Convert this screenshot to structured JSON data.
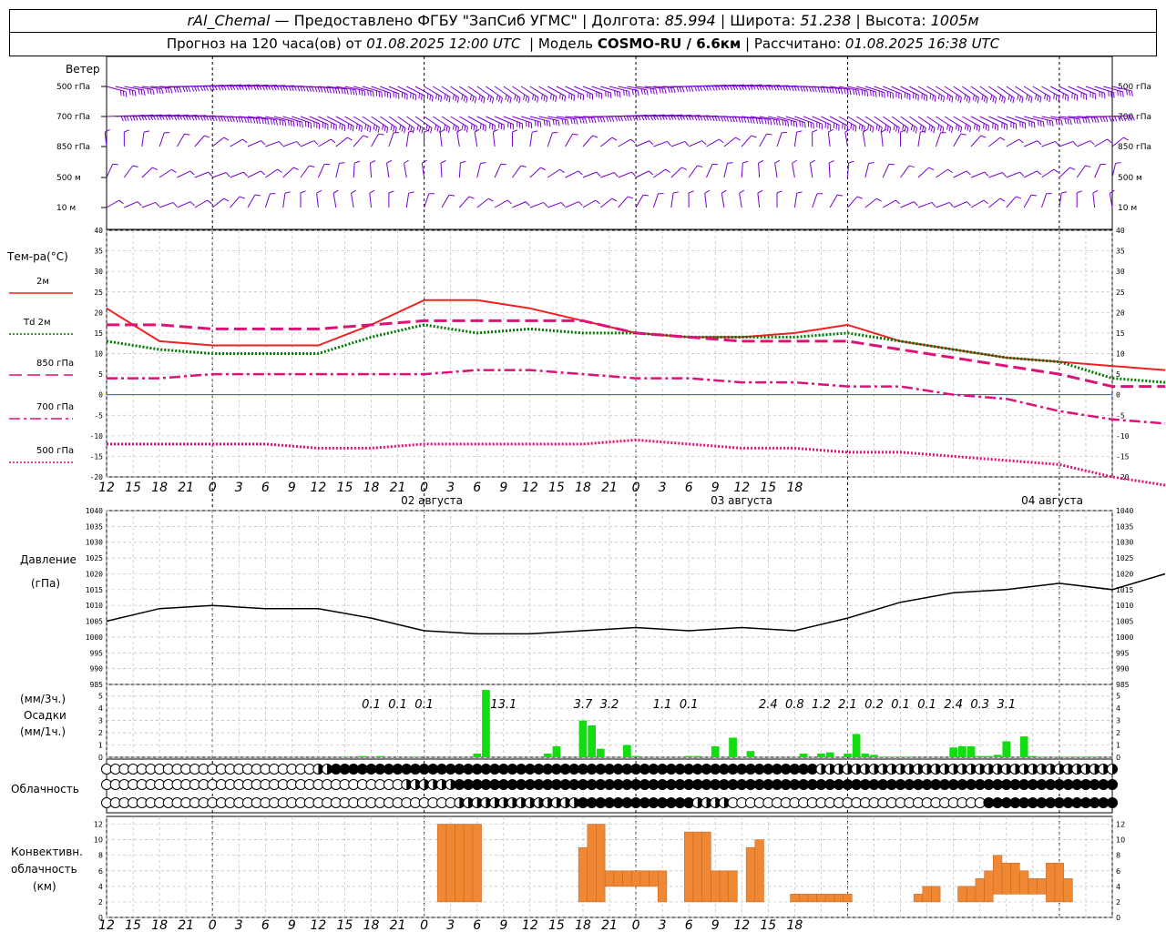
{
  "header": {
    "row1": {
      "station": "rAl_Chemal",
      "provider": "— Предоставлено ФГБУ \"ЗапСиб УГМС\"",
      "lon_label": "Долгота:",
      "lon": "85.994",
      "lat_label": "Широта:",
      "lat": "51.238",
      "alt_label": "Высота:",
      "alt": "1005м"
    },
    "row2": {
      "forecast": "Прогноз на 120 часа(ов) от",
      "issued": "01.08.2025 12:00 UTC",
      "model_label": "Модель",
      "model": "COSMO-RU / 6.6км",
      "calc_label": "Рассчитано:",
      "calc": "01.08.2025 16:38 UTC"
    }
  },
  "wind_panel": {
    "title": "Ветер",
    "levels": [
      "500 гПа",
      "700 гПа",
      "850 гПа",
      "500 м",
      "10 м"
    ],
    "color": "#7700cc"
  },
  "temp_panel": {
    "title": "Тем-ра(°C)",
    "legend": [
      {
        "label": "2м",
        "color": "#ee2222",
        "style": "solid"
      },
      {
        "label": "Td 2м",
        "color": "#007700",
        "style": "dotted"
      },
      {
        "label": "850 гПа",
        "color": "#dd1177",
        "style": "dash"
      },
      {
        "label": "700 гПа",
        "color": "#dd1177",
        "style": "dashdot"
      },
      {
        "label": "500 гПа",
        "color": "#dd1177",
        "style": "dots"
      }
    ],
    "yticks": [
      "40",
      "35",
      "30",
      "25",
      "20",
      "15",
      "10",
      "5",
      "0",
      "-5",
      "-10",
      "-15",
      "-20"
    ],
    "xticks": [
      "12",
      "15",
      "18",
      "21",
      "0",
      "3",
      "6",
      "9",
      "12",
      "15",
      "18",
      "21",
      "0",
      "3",
      "6",
      "9",
      "12",
      "15",
      "18",
      "21",
      "0",
      "3",
      "6",
      "9",
      "12",
      "15",
      "18"
    ],
    "dates": [
      "02 августа",
      "03 августа",
      "04 августа"
    ]
  },
  "pressure_panel": {
    "title1": "Давление",
    "title2": "(гПа)",
    "yticks": [
      "1040",
      "1035",
      "1030",
      "1025",
      "1020",
      "1015",
      "1010",
      "1005",
      "1000",
      "995",
      "990",
      "985"
    ]
  },
  "precip_panel": {
    "label1": "(мм/3ч.)",
    "label2": "Осадки",
    "label3": "(мм/1ч.)",
    "yticks": [
      "5",
      "4",
      "3",
      "2",
      "1",
      "0"
    ],
    "totals": [
      "0.1",
      "0.1",
      "0.1",
      "13.1",
      "3.7",
      "3.2",
      "1.1",
      "0.1",
      "2.4",
      "0.8",
      "1.2",
      "2.1",
      "0.2",
      "0.1",
      "0.1",
      "2.4",
      "0.3",
      "3.1"
    ],
    "color": "#11dd11"
  },
  "cloud_panel": {
    "title": "Облачность"
  },
  "conv_panel": {
    "title1": "Конвективн.",
    "title2": "облачность",
    "title3": "(км)",
    "yticks": [
      "12",
      "10",
      "8",
      "6",
      "4",
      "2",
      "0"
    ],
    "color": "#ee8833"
  },
  "chart_data": [
    {
      "type": "line",
      "title": "Тем-ра(°C)",
      "ylim": [
        -20,
        40
      ],
      "x_hours_from_start": [
        0,
        6,
        12,
        18,
        24,
        30,
        36,
        42,
        48,
        54,
        60,
        66,
        72,
        78,
        84,
        90,
        96,
        102,
        108,
        114,
        120
      ],
      "series": [
        {
          "name": "2м",
          "values": [
            21,
            13,
            12,
            12,
            12,
            17,
            23,
            23,
            21,
            18,
            15,
            14,
            14,
            15,
            17,
            13,
            11,
            9,
            8,
            7,
            6
          ]
        },
        {
          "name": "Td 2м",
          "values": [
            13,
            11,
            10,
            10,
            10,
            14,
            17,
            15,
            16,
            15,
            15,
            14,
            14,
            14,
            15,
            13,
            11,
            9,
            8,
            4,
            3
          ]
        },
        {
          "name": "850 гПа",
          "values": [
            17,
            17,
            16,
            16,
            16,
            17,
            18,
            18,
            18,
            18,
            15,
            14,
            13,
            13,
            13,
            11,
            9,
            7,
            5,
            2,
            2
          ]
        },
        {
          "name": "700 гПа",
          "values": [
            4,
            4,
            5,
            5,
            5,
            5,
            5,
            6,
            6,
            5,
            4,
            4,
            3,
            3,
            2,
            2,
            0,
            -1,
            -4,
            -6,
            -7
          ]
        },
        {
          "name": "500 гПа",
          "values": [
            -12,
            -12,
            -12,
            -12,
            -13,
            -13,
            -12,
            -12,
            -12,
            -12,
            -11,
            -12,
            -13,
            -13,
            -14,
            -14,
            -15,
            -16,
            -17,
            -20,
            -22
          ]
        }
      ]
    },
    {
      "type": "line",
      "title": "Давление (гПа)",
      "ylim": [
        985,
        1040
      ],
      "x_hours_from_start": [
        0,
        6,
        12,
        18,
        24,
        30,
        36,
        42,
        48,
        54,
        60,
        66,
        72,
        78,
        84,
        90,
        96,
        102,
        108,
        114,
        120
      ],
      "series": [
        {
          "name": "Давление",
          "values": [
            1005,
            1009,
            1010,
            1009,
            1009,
            1006,
            1002,
            1001,
            1001,
            1002,
            1003,
            1002,
            1003,
            1002,
            1006,
            1011,
            1014,
            1015,
            1017,
            1015,
            1020
          ]
        }
      ]
    },
    {
      "type": "bar",
      "title": "Осадки (мм/1ч.)",
      "ylim": [
        0,
        5
      ],
      "x_hours_from_start": [
        27,
        29,
        31,
        35,
        42,
        43,
        50,
        51,
        54,
        55,
        56,
        59,
        60,
        66,
        67,
        69,
        71,
        73,
        79,
        81,
        82,
        84,
        85,
        86,
        87,
        88,
        89,
        90,
        91,
        96,
        97,
        98,
        99,
        100,
        101,
        102,
        104,
        105,
        106,
        108,
        109,
        110,
        111,
        112
      ],
      "values": [
        0.05,
        0.1,
        0.1,
        0.05,
        0.3,
        7.2,
        0.3,
        0.9,
        3.0,
        2.6,
        0.7,
        1.0,
        0.1,
        0.1,
        0.1,
        0.9,
        1.6,
        0.5,
        0.3,
        0.3,
        0.4,
        0.3,
        1.9,
        0.3,
        0.2,
        0.05,
        0.05,
        0.05,
        0.05,
        0.8,
        0.9,
        0.9,
        0.1,
        0.1,
        0.2,
        1.3,
        1.7,
        0.1,
        0.05,
        0.05,
        0.05,
        0.05,
        0.05,
        0.05
      ]
    },
    {
      "type": "bar",
      "title": "Конвективн. облачность (км)",
      "ylim": [
        0,
        13
      ],
      "x_hours_from_start": [
        38,
        39,
        40,
        41,
        42,
        54,
        55,
        56,
        57,
        58,
        59,
        60,
        61,
        62,
        63,
        66,
        67,
        68,
        69,
        70,
        71,
        72,
        73,
        74,
        78,
        79,
        80,
        81,
        82,
        83,
        84,
        92,
        93,
        94,
        97,
        98,
        99,
        100,
        101,
        102,
        103,
        104,
        105,
        106,
        107,
        108,
        109
      ],
      "bottom": [
        2,
        2,
        2,
        2,
        2,
        2,
        2,
        2,
        4,
        4,
        4,
        4,
        4,
        4,
        2,
        2,
        2,
        2,
        2,
        2,
        2,
        2,
        2,
        2,
        2,
        2,
        2,
        2,
        2,
        2,
        2,
        2,
        2,
        2,
        2,
        2,
        2,
        2,
        3,
        3,
        3,
        3,
        3,
        3,
        2,
        2,
        2
      ],
      "top": [
        12,
        12,
        12,
        12,
        12,
        9,
        12,
        12,
        6,
        6,
        6,
        6,
        6,
        6,
        6,
        11,
        11,
        11,
        6,
        6,
        6,
        2,
        9,
        10,
        3,
        3,
        3,
        3,
        3,
        3,
        3,
        3,
        4,
        4,
        4,
        4,
        5,
        6,
        8,
        7,
        7,
        6,
        5,
        5,
        7,
        7,
        5
      ]
    }
  ]
}
